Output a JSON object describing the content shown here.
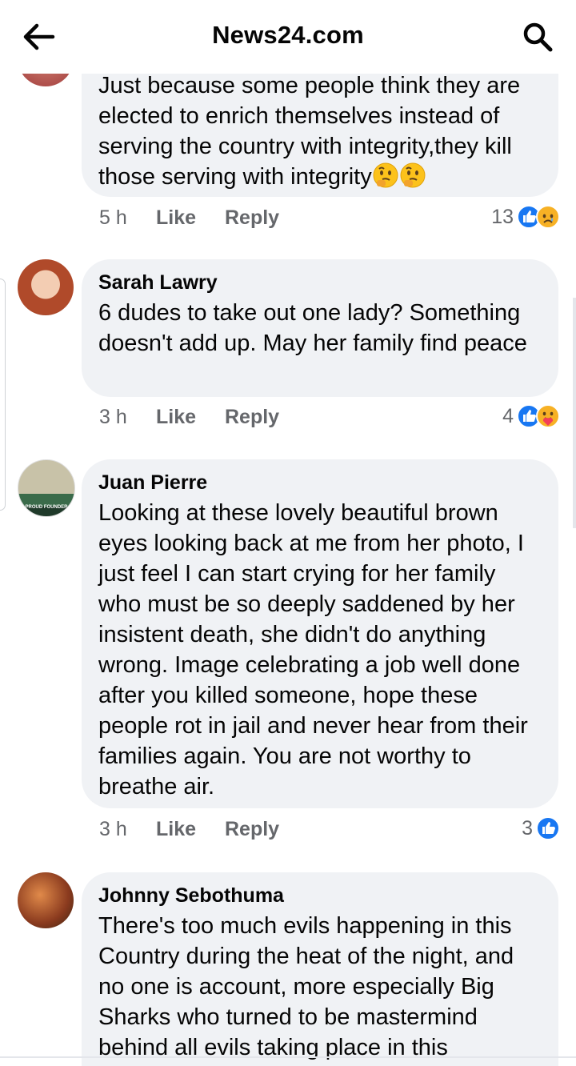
{
  "header": {
    "title": "News24.com"
  },
  "icons": {
    "back": "arrow-left-icon",
    "search": "search-icon",
    "like": "like-reaction-icon",
    "sad": "sad-reaction-icon",
    "care": "care-reaction-icon",
    "thinking": "thinking-face-emoji"
  },
  "colors": {
    "like_blue": "#1877f2",
    "bubble": "#f0f2f5",
    "meta_gray": "#65676b"
  },
  "comments": [
    {
      "author": "",
      "text": "Just because some  people think they are elected to enrich themselves instead of serving the country with integrity,they kill those serving with integrity",
      "time": "5 h",
      "like": "Like",
      "reply": "Reply",
      "reaction_count": "13"
    },
    {
      "author": "Sarah Lawry",
      "text": "6 dudes to take out one lady? Something doesn't add up. May her family find peace",
      "time": "3 h",
      "like": "Like",
      "reply": "Reply",
      "reaction_count": "4"
    },
    {
      "author": "Juan Pierre",
      "text": "Looking at these lovely beautiful brown eyes looking back at me from her photo, I just feel I can start crying for her family who must be so deeply saddened by her insistent death, she didn't do anything wrong. Image celebrating a job well done after you killed someone, hope these people rot in jail and never hear from their families again. You are not worthy to breathe air.",
      "time": "3 h",
      "like": "Like",
      "reply": "Reply",
      "reaction_count": "3",
      "avatar_badge": "PROUD FOUNDER"
    },
    {
      "author": "Johnny Sebothuma",
      "text": "There's too much evils happening in this Country during the heat of the night, and no one is account, more especially Big Sharks who turned to be mastermind behind all evils taking place in this"
    }
  ]
}
